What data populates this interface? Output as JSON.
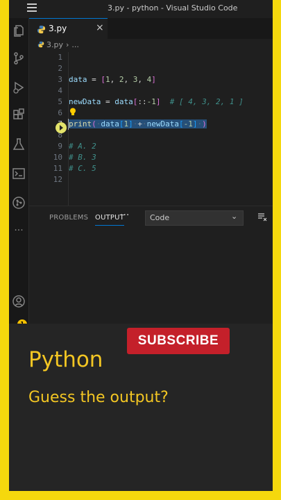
{
  "window": {
    "title": "3.py - python - Visual Studio Code"
  },
  "activity_bar": {
    "icons": [
      "explorer-icon",
      "source-control-icon",
      "run-debug-icon",
      "extensions-icon",
      "testing-icon",
      "terminal-icon",
      "github-icon",
      "more-icon",
      "account-icon"
    ],
    "badge": "1"
  },
  "editor": {
    "tab": {
      "label": "3.py",
      "close": "×"
    },
    "breadcrumb": {
      "file": "3.py",
      "more": "..."
    },
    "line_numbers": [
      "1",
      "2",
      "3",
      "4",
      "5",
      "6",
      "7",
      "8",
      "9",
      "10",
      "11",
      "12"
    ],
    "code": {
      "l3": {
        "var": "data",
        "eq": " = ",
        "open": "[",
        "n1": "1",
        "c1": ", ",
        "n2": "2",
        "c2": ", ",
        "n3": "3",
        "c3": ", ",
        "n4": "4",
        "close": "]"
      },
      "l5": {
        "var": "newData",
        "eq": " = ",
        "var2": "data",
        "open": "[",
        "slice": "::",
        "neg": "-1",
        "close": "]",
        "comment": "  # [ 4, 3, 2, 1 ]"
      },
      "l7": {
        "fn": "print",
        "open": "(",
        "d1": "·",
        "var": "data",
        "b1o": "[",
        "n1": "1",
        "b1c": "]",
        "d2": "·",
        "plus": "+",
        "d3": "·",
        "var2": "newData",
        "b2o": "[",
        "n2": "-1",
        "b2c": "]",
        "d4": "·",
        "close": ")"
      },
      "l9": "# A. 2",
      "l10": "# B. 3",
      "l11": "# C. 5"
    }
  },
  "panel": {
    "tabs": [
      "PROBLEMS",
      "OUTPUT"
    ],
    "more": "···",
    "output_channel": "Code"
  },
  "overlay": {
    "subscribe": "SUBSCRIBE",
    "heading": "Python",
    "subheading": "Guess the output?"
  },
  "colors": {
    "border": "#f5d80d",
    "subscribe": "#c4202a",
    "heading": "#f3c623",
    "accent": "#0078d4"
  }
}
